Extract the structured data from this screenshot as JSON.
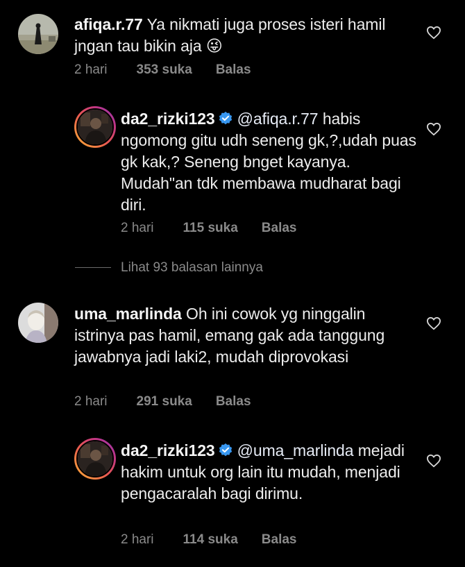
{
  "comments": [
    {
      "username": "afiqa.r.77",
      "text": "Ya nikmati juga proses isteri hamil jngan tau bikin aja",
      "emoji": "😜",
      "time": "2 hari",
      "likes": "353 suka",
      "reply": "Balas"
    },
    {
      "username": "da2_rizki123",
      "mention": "@afiqa.r.77",
      "text": "habis ngomong gitu udh seneng gk,?,udah puas gk kak,? Seneng bnget kayanya. Mudah\"an tdk membawa mudharat bagi diri.",
      "time": "2 hari",
      "likes": "115 suka",
      "reply": "Balas"
    },
    {
      "username": "uma_marlinda",
      "text": "Oh ini cowok yg ninggalin istrinya pas hamil, emang gak ada tanggung jawabnya jadi laki2, mudah diprovokasi",
      "time": "2 hari",
      "likes": "291 suka",
      "reply": "Balas"
    },
    {
      "username": "da2_rizki123",
      "mention": "@uma_marlinda",
      "text": "mejadi hakim untuk org lain itu mudah, menjadi pengacaralah bagi dirimu.",
      "time": "2 hari",
      "likes": "114 suka",
      "reply": "Balas"
    }
  ],
  "view_replies": "Lihat 93 balasan lainnya",
  "icons": {
    "like": "heart-outline-icon",
    "verified": "verified-badge-icon"
  },
  "colors": {
    "background": "#000000",
    "text": "#ededed",
    "meta": "#8a8a8a",
    "verified": "#3897f0"
  }
}
